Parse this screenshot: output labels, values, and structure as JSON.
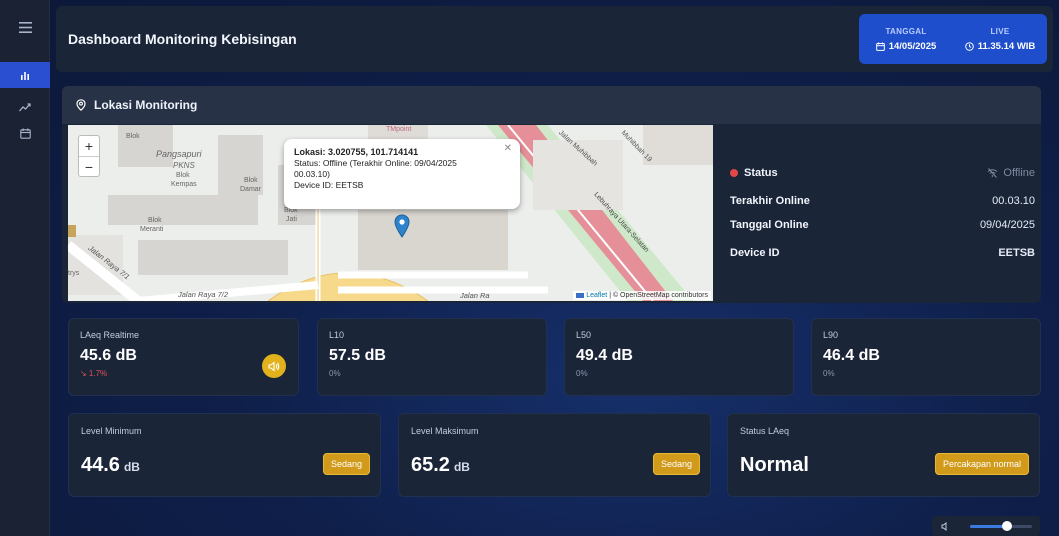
{
  "sidebar": {
    "menu_icon": "menu-icon",
    "items": [
      {
        "icon": "bar-chart-icon",
        "active": true
      },
      {
        "icon": "trend-icon",
        "active": false
      },
      {
        "icon": "calendar-icon",
        "active": false
      }
    ]
  },
  "header": {
    "title": "Dashboard Monitoring Kebisingan",
    "date_label": "TANGGAL",
    "date_value": "14/05/2025",
    "live_label": "LIVE",
    "time_value": "11.35.14 WIB"
  },
  "map": {
    "title": "Lokasi Monitoring",
    "zoom_in": "+",
    "zoom_out": "−",
    "popup": {
      "title": "Lokasi: 3.020755, 101.714141",
      "line2": "Status: Offline (Terakhir Online: 09/04/2025",
      "line3": "00.03.10)",
      "line4": "Device ID: EETSB"
    },
    "labels": {
      "pangsapuri": "Pangsapuri",
      "pkns": "PKNS",
      "blok_kempas": "Blok",
      "kempas": "Kempas",
      "blok_damar": "Blok",
      "damar": "Damar",
      "blok_jati": "Blok",
      "jati": "Jati",
      "blok_meranti": "Blok",
      "meranti": "Meranti",
      "jalan_raya_71": "Jalan Raya 7/1",
      "jalan_raya_72": "Jalan Raya 7/2",
      "jalan_ra": "Jalan Ra",
      "jalan_muhibbah": "Jalan Muhibbah",
      "muhibbah19": "Muhibbah 19",
      "lebuhraya": "Lebuhraya Utara-Selatan",
      "tmpoint": "TMpoint",
      "blok": "Blok",
      "trys": "trys"
    },
    "attribution_leaflet": "Leaflet",
    "attribution_osm": "| © OpenStreetMap contributors"
  },
  "status": {
    "status_label": "Status",
    "status_value": "Offline",
    "status_color": "#e04848",
    "terakhir_label": "Terakhir Online",
    "terakhir_value": "00.03.10",
    "tanggal_label": "Tanggal Online",
    "tanggal_value": "09/04/2025",
    "device_label": "Device ID",
    "device_value": "EETSB"
  },
  "metrics": [
    {
      "label": "LAeq Realtime",
      "value": "45.6 dB",
      "sub": "↘ 1.7%"
    },
    {
      "label": "L10",
      "value": "57.5 dB",
      "sub": "0%"
    },
    {
      "label": "L50",
      "value": "49.4 dB",
      "sub": "0%"
    },
    {
      "label": "L90",
      "value": "46.4 dB",
      "sub": "0%"
    }
  ],
  "levels": [
    {
      "label": "Level Minimum",
      "value": "44.6",
      "unit": "dB",
      "badge": "Sedang"
    },
    {
      "label": "Level Maksimum",
      "value": "65.2",
      "unit": "dB",
      "badge": "Sedang"
    },
    {
      "label": "Status LAeq",
      "value": "Normal",
      "unit": "",
      "badge": "Percakapan normal"
    }
  ],
  "volume": {
    "level": 0.6
  },
  "colors": {
    "accent": "#2a4fd0",
    "badge": "#d19a1a",
    "speaker": "#e2b21d"
  }
}
